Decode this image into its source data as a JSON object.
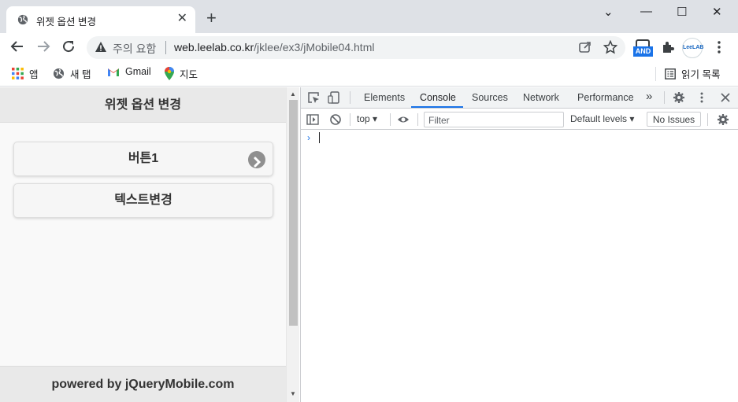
{
  "browser": {
    "tab_title": "위젯 옵션 변경",
    "tab_close": "✕",
    "new_tab": "+",
    "window_controls": [
      "⌄",
      "—",
      "☐",
      "✕"
    ],
    "security_label": "주의 요함",
    "url_host": "web.leelab.co.kr",
    "url_path": "/jklee/ex3/jMobile04.html",
    "ext_badge": "AND",
    "profile_label": "LeeLAB"
  },
  "bookmarks": {
    "apps": "앱",
    "new_tab": "새 탭",
    "gmail": "Gmail",
    "maps": "지도",
    "reading_list": "읽기 목록"
  },
  "page": {
    "header": "위젯 옵션 변경",
    "buttons": [
      {
        "label": "버튼1",
        "icon": "arrow-right-icon"
      },
      {
        "label": "텍스트변경"
      }
    ],
    "footer": "powered by jQueryMobile.com"
  },
  "devtools": {
    "tabs": [
      "Elements",
      "Console",
      "Sources",
      "Network",
      "Performance"
    ],
    "active_tab": "Console",
    "more_tabs": "»",
    "context": "top",
    "filter_placeholder": "Filter",
    "levels": "Default levels",
    "issues": "No Issues",
    "prompt": "›"
  },
  "colors": {
    "accent": "#1a73e8",
    "tabstrip": "#dee1e6",
    "jqm_bar": "#e9e9e9"
  }
}
